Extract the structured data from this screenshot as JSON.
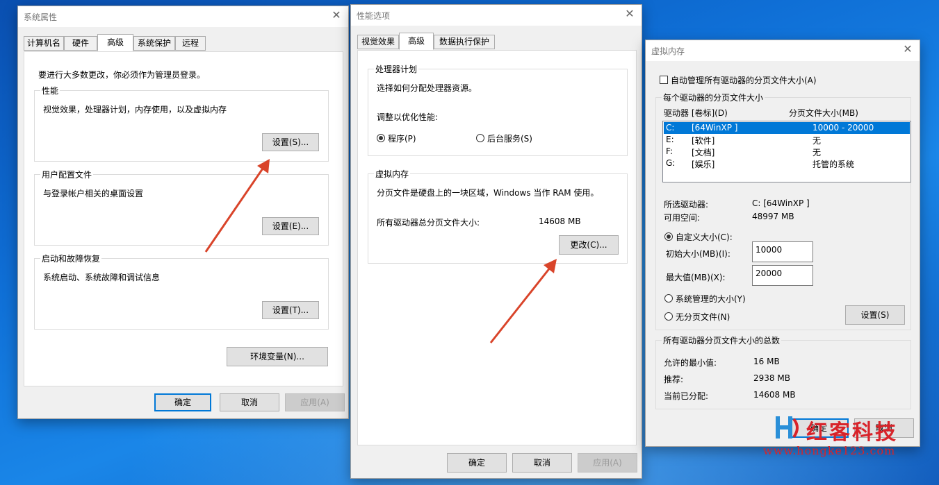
{
  "colors": {
    "desktop": "#0f6fd6",
    "accent": "#0078d7",
    "arrow": "#d9442a",
    "watermark": "#d8232a"
  },
  "system_props": {
    "title": "系统属性",
    "tabs": [
      "计算机名",
      "硬件",
      "高级",
      "系统保护",
      "远程"
    ],
    "admin_note": "要进行大多数更改，你必须作为管理员登录。",
    "performance": {
      "title": "性能",
      "desc": "视觉效果，处理器计划，内存使用，以及虚拟内存",
      "button": "设置(S)..."
    },
    "profile": {
      "title": "用户配置文件",
      "desc": "与登录帐户相关的桌面设置",
      "button": "设置(E)..."
    },
    "startup": {
      "title": "启动和故障恢复",
      "desc": "系统启动、系统故障和调试信息",
      "button": "设置(T)..."
    },
    "env_button": "环境变量(N)...",
    "ok": "确定",
    "cancel": "取消",
    "apply": "应用(A)"
  },
  "perf_options": {
    "title": "性能选项",
    "tabs": [
      "视觉效果",
      "高级",
      "数据执行保护"
    ],
    "scheduling": {
      "title": "处理器计划",
      "desc": "选择如何分配处理器资源。",
      "optimize": "调整以优化性能:",
      "opt_programs": "程序(P)",
      "opt_services": "后台服务(S)"
    },
    "virtual_memory": {
      "title": "虚拟内存",
      "desc": "分页文件是硬盘上的一块区域，Windows 当作 RAM 使用。",
      "total_label": "所有驱动器总分页文件大小:",
      "total_value": "14608 MB",
      "button": "更改(C)..."
    },
    "ok": "确定",
    "cancel": "取消",
    "apply": "应用(A)"
  },
  "virtual_mem": {
    "title": "虚拟内存",
    "auto_manage": "自动管理所有驱动器的分页文件大小(A)",
    "group_title": "每个驱动器的分页文件大小",
    "col_drive": "驱动器 [卷标](D)",
    "col_size": "分页文件大小(MB)",
    "drives": [
      {
        "letter": "C:",
        "label": "[64WinXP ]",
        "size": "10000 - 20000"
      },
      {
        "letter": "E:",
        "label": "[软件]",
        "size": "无"
      },
      {
        "letter": "F:",
        "label": "[文档]",
        "size": "无"
      },
      {
        "letter": "G:",
        "label": "[娱乐]",
        "size": "托管的系统"
      }
    ],
    "selected_label": "所选驱动器:",
    "selected_value": "C:  [64WinXP ]",
    "free_label": "可用空间:",
    "free_value": "48997 MB",
    "custom_size": "自定义大小(C):",
    "initial_label": "初始大小(MB)(I):",
    "initial_value": "10000",
    "max_label": "最大值(MB)(X):",
    "max_value": "20000",
    "system_managed": "系统管理的大小(Y)",
    "no_paging": "无分页文件(N)",
    "set_button": "设置(S)",
    "totals_title": "所有驱动器分页文件大小的总数",
    "min_label": "允许的最小值:",
    "min_value": "16 MB",
    "rec_label": "推荐:",
    "rec_value": "2938 MB",
    "cur_label": "当前已分配:",
    "cur_value": "14608 MB",
    "ok": "确定",
    "cancel": "取消"
  },
  "watermark": {
    "name": "红客科技",
    "url": "www.hongke123.com"
  }
}
